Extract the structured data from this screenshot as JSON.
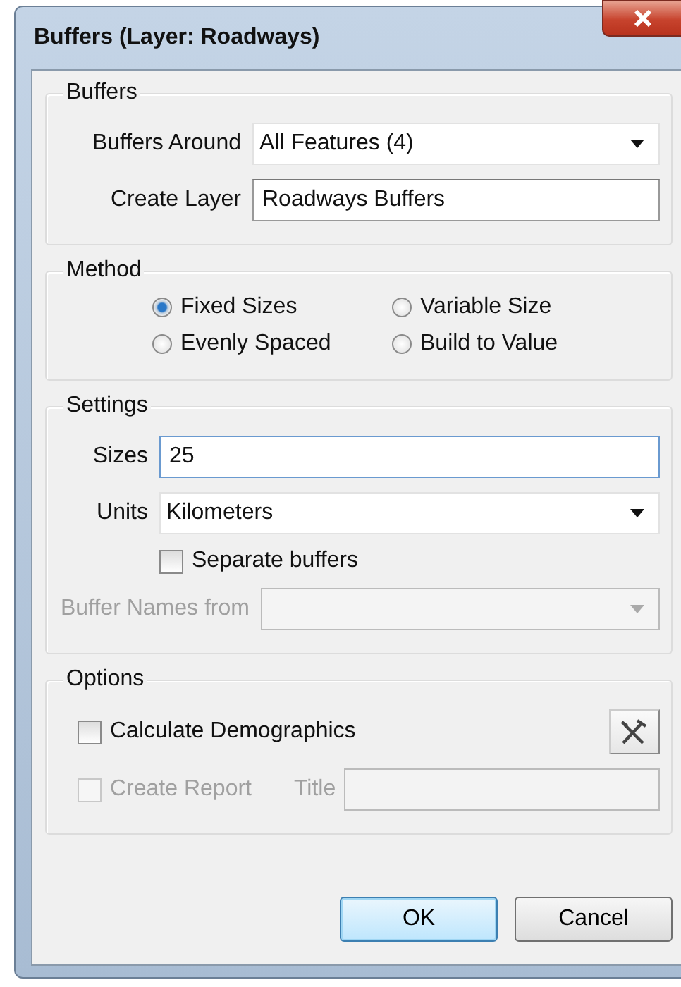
{
  "window": {
    "title": "Buffers (Layer: Roadways)"
  },
  "buffers": {
    "title": "Buffers",
    "fields": [
      {
        "kind": "dropdown",
        "label": "Buffers Around",
        "value": "All Features (4)"
      },
      {
        "kind": "text",
        "label": "Create Layer",
        "value": "Roadways Buffers"
      }
    ]
  },
  "method": {
    "title": "Method",
    "options": [
      {
        "label": "Fixed Sizes",
        "selected": true
      },
      {
        "label": "Variable Size",
        "selected": false
      },
      {
        "label": "Evenly Spaced",
        "selected": false
      },
      {
        "label": "Build to Value",
        "selected": false
      }
    ]
  },
  "settings": {
    "title": "Settings",
    "fields": [
      {
        "kind": "text",
        "label": "Sizes",
        "value": "25",
        "focused": true
      },
      {
        "kind": "dropdown",
        "label": "Units",
        "value": "Kilometers"
      },
      {
        "kind": "checkbox",
        "label": "Separate buffers",
        "checked": false
      },
      {
        "kind": "dropdown",
        "label": "Buffer Names  from",
        "disabled": true
      }
    ]
  },
  "options": {
    "title": "Options",
    "items": [
      {
        "label": "Calculate Demographics",
        "checked": false,
        "disabled": false,
        "tool_button": true
      },
      {
        "label": "Create Report",
        "checked": false,
        "disabled": true,
        "field_label": "Title"
      }
    ]
  },
  "buttons": [
    {
      "label": "OK",
      "default": true
    },
    {
      "label": "Cancel",
      "default": false
    }
  ]
}
